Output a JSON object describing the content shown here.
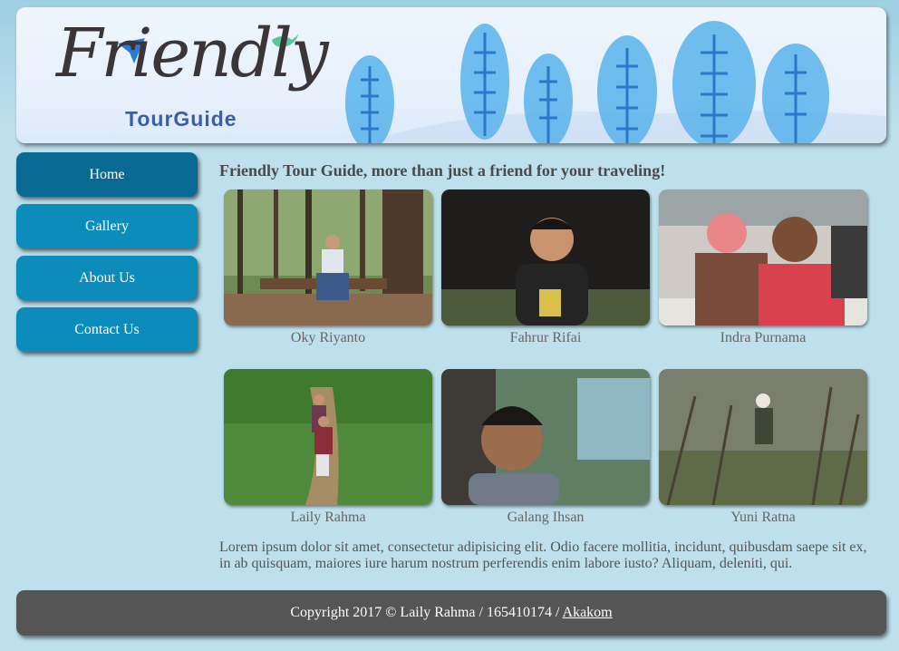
{
  "header": {
    "logo_word": "Friendly",
    "logo_sub": "TourGuide"
  },
  "nav": {
    "items": [
      {
        "label": "Home",
        "active": true
      },
      {
        "label": "Gallery",
        "active": false
      },
      {
        "label": "About Us",
        "active": false
      },
      {
        "label": "Contact Us",
        "active": false
      }
    ]
  },
  "main": {
    "title": "Friendly Tour Guide, more than just a friend for your traveling!",
    "gallery": [
      {
        "name": "Oky Riyanto",
        "scene": "forest"
      },
      {
        "name": "Fahrur Rifai",
        "scene": "night"
      },
      {
        "name": "Indra Purnama",
        "scene": "classroom"
      },
      {
        "name": "Laily Rahma",
        "scene": "hill"
      },
      {
        "name": "Galang Ihsan",
        "scene": "selfie"
      },
      {
        "name": "Yuni Ratna",
        "scene": "bush"
      }
    ],
    "description": "Lorem ipsum dolor sit amet, consectetur adipisicing elit. Odio facere mollitia, incidunt, quibusdam saepe sit ex, in ab quisquam, maiores iure harum nostrum perferendis enim labore iusto? Aliquam, deleniti, qui."
  },
  "footer": {
    "text": "Copyright 2017 © Laily Rahma / 165410174 / ",
    "link": "Akakom"
  },
  "colors": {
    "page_bg": "#bde0ec",
    "nav_button": "#0b8cbb",
    "nav_button_active": "#086a92",
    "footer_bg": "#565555"
  }
}
